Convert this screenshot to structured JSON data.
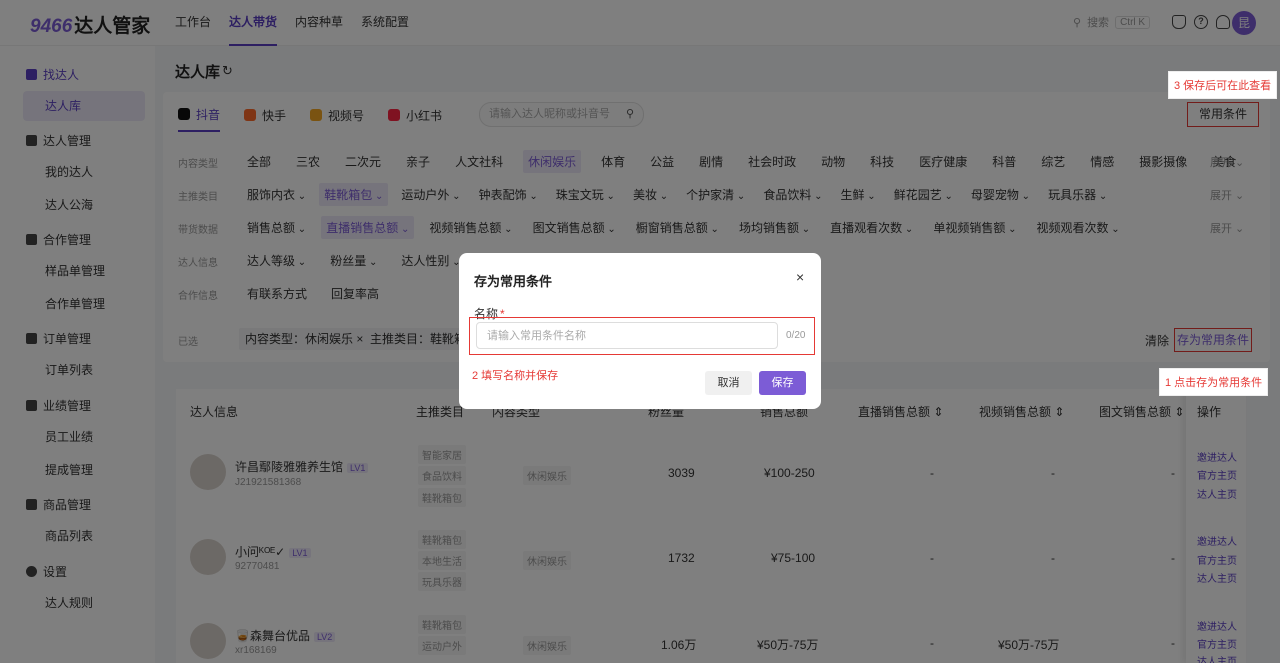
{
  "app": {
    "logo_num": "9466",
    "logo_text": "达人管家",
    "nav": [
      "工作台",
      "达人带货",
      "内容种草",
      "系统配置"
    ],
    "search_label": "搜索",
    "search_kbd": "Ctrl K",
    "avatar_initial": "昆"
  },
  "sidebar": {
    "groups": {
      "find": "找达人",
      "manage": "达人管理",
      "coop": "合作管理",
      "order": "订单管理",
      "perf": "业绩管理",
      "goods": "商品管理",
      "settings": "设置"
    },
    "items": {
      "library": "达人库",
      "mine": "我的达人",
      "public": "达人公海",
      "sample": "样品单管理",
      "coop_orders": "合作单管理",
      "order_list": "订单列表",
      "staff_perf": "员工业绩",
      "commission": "提成管理",
      "goods_list": "商品列表",
      "rules": "达人规则"
    }
  },
  "page": {
    "title": "达人库",
    "platforms": [
      "抖音",
      "快手",
      "视频号",
      "小红书"
    ],
    "search_placeholder": "请输入达人昵称或抖音号",
    "common_conditions": "常用条件",
    "expand": "展开"
  },
  "filters": {
    "labels": [
      "内容类型",
      "主推类目",
      "带货数据",
      "达人信息",
      "合作信息"
    ],
    "content_types": [
      "全部",
      "三农",
      "二次元",
      "亲子",
      "人文社科",
      "休闲娱乐",
      "体育",
      "公益",
      "剧情",
      "社会时政",
      "动物",
      "科技",
      "医疗健康",
      "科普",
      "综艺",
      "情感",
      "摄影摄像",
      "美食"
    ],
    "categories": [
      "服饰内衣",
      "鞋靴箱包",
      "运动户外",
      "钟表配饰",
      "珠宝文玩",
      "美妆",
      "个护家清",
      "食品饮料",
      "生鲜",
      "鲜花园艺",
      "母婴宠物",
      "玩具乐器"
    ],
    "sales_data": [
      "销售总额",
      "直播销售总额",
      "视频销售总额",
      "图文销售总额",
      "橱窗销售总额",
      "场均销售额",
      "直播观看次数",
      "单视频销售额",
      "视频观看次数"
    ],
    "creator_info": [
      "达人等级",
      "粉丝量",
      "达人性别"
    ],
    "coop_info": [
      "有联系方式",
      "回复率高"
    ],
    "chosen_label": "已选",
    "chosen_tags": [
      "内容类型：休闲娱乐 ×",
      "主推类目：鞋靴箱"
    ],
    "clear": "清除",
    "save_as_common": "存为常用条件"
  },
  "table": {
    "headers": [
      "达人信息",
      "主推类目",
      "内容类型",
      "粉丝量",
      "销售总额",
      "直播销售总额 ⇕",
      "视频销售总额 ⇕",
      "图文销售总额 ⇕",
      "操作"
    ],
    "rows": [
      {
        "name": "许昌鄢陵雅雅养生馆",
        "lv": "LV1",
        "id": "J21921581368",
        "cats": [
          "智能家居",
          "食品饮料",
          "鞋靴箱包"
        ],
        "content": "休闲娱乐",
        "fans": "3039",
        "sales": "¥100-250",
        "live": "-",
        "video": "-",
        "text": "-"
      },
      {
        "name": "小问ᴷᴼᴱ✓",
        "lv": "LV1",
        "id": "92770481",
        "cats": [
          "鞋靴箱包",
          "本地生活",
          "玩具乐器"
        ],
        "content": "休闲娱乐",
        "fans": "1732",
        "sales": "¥75-100",
        "live": "-",
        "video": "-",
        "text": "-"
      },
      {
        "name": "🥃森舞台优品",
        "lv": "LV2",
        "id": "xr168169",
        "cats": [
          "鞋靴箱包",
          "运动户外",
          "服饰内衣"
        ],
        "content": "休闲娱乐",
        "fans": "1.06万",
        "sales": "¥50万-75万",
        "live": "-",
        "video": "¥50万-75万",
        "text": "-"
      }
    ],
    "ops": [
      "邀进达人",
      "官方主页",
      "达人主页"
    ]
  },
  "dialog": {
    "title": "存为常用条件",
    "close": "×",
    "label": "名称",
    "required_mark": "*",
    "placeholder": "请输入常用条件名称",
    "counter": "0/20",
    "cancel": "取消",
    "save": "保存"
  },
  "annotations": {
    "step1": "1 点击存为常用条件",
    "step2": "2 填写名称并保存",
    "step3": "3 保存后可在此查看"
  }
}
